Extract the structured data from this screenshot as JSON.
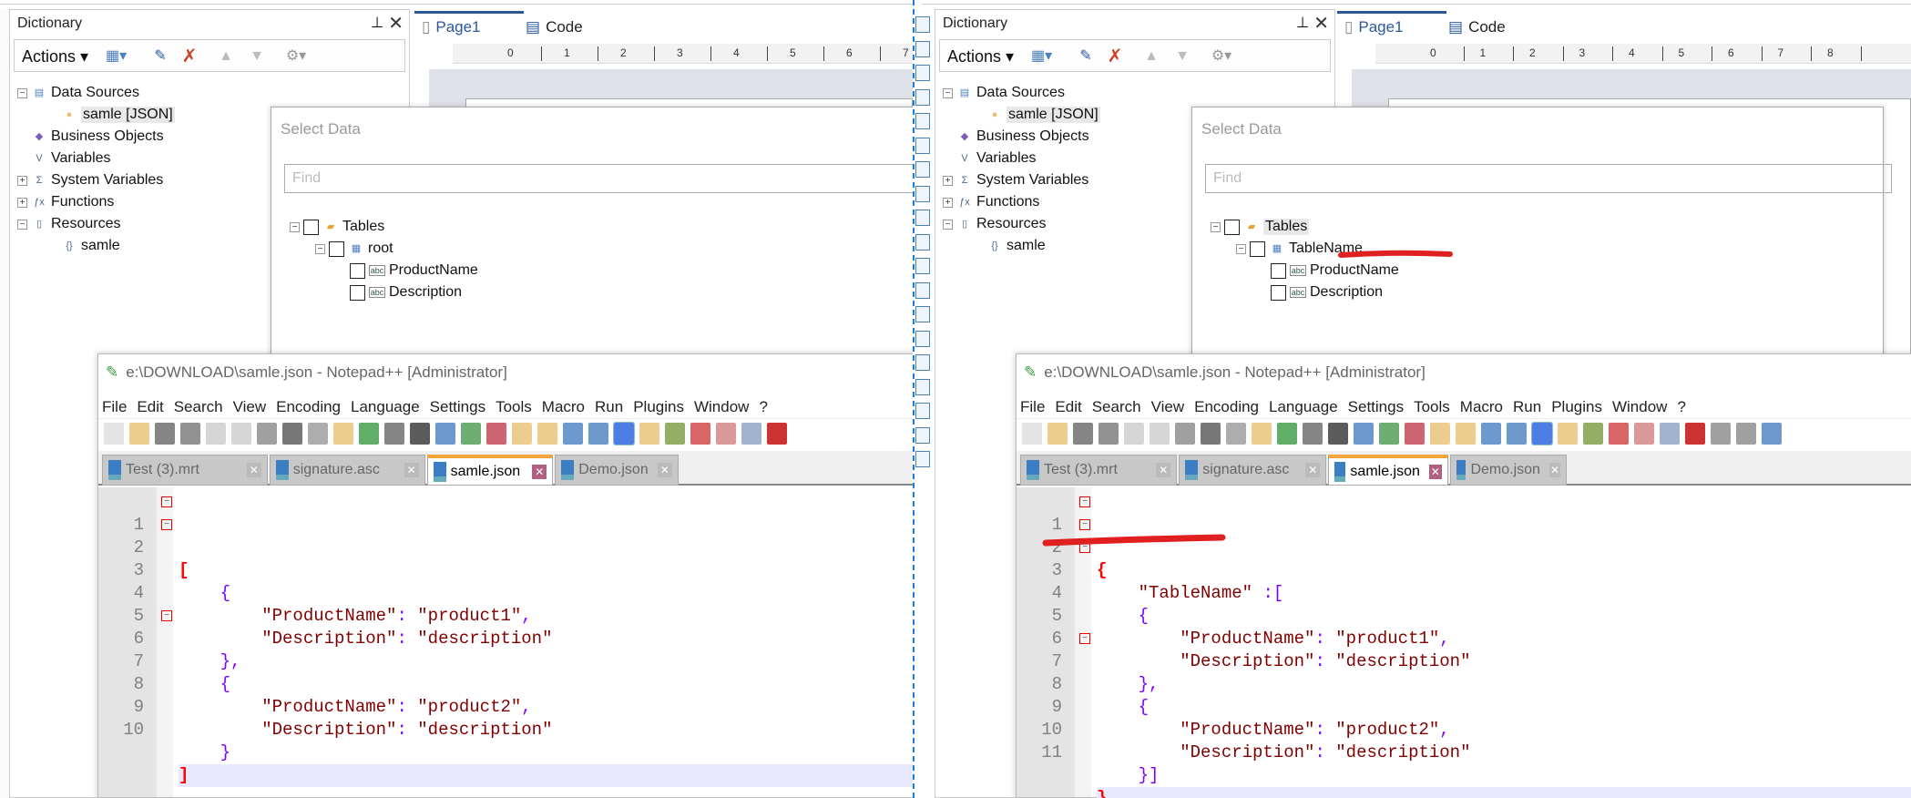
{
  "colors": {
    "accent": "#2b579a",
    "annotation": "#e02020",
    "tab_active": "#f6a43c",
    "string": "#800000",
    "operator": "#8000ff",
    "brace_match": "#ff0000",
    "current_line": "#e8e8ff"
  },
  "panels": [
    {
      "dictionary": {
        "title": "Dictionary",
        "actions_label": "Actions",
        "tree": [
          {
            "label": "Data Sources",
            "icon": "datasource-icon",
            "expander": "−",
            "level": 0
          },
          {
            "label": "samle [JSON]",
            "icon": "database-icon",
            "level": 1,
            "selected": true
          },
          {
            "label": "Business Objects",
            "icon": "business-objects-icon",
            "level": 0
          },
          {
            "label": "Variables",
            "icon": "variables-icon",
            "level": 0
          },
          {
            "label": "System Variables",
            "icon": "system-variables-icon",
            "expander": "+",
            "level": 0
          },
          {
            "label": "Functions",
            "icon": "function-icon",
            "expander": "+",
            "level": 0
          },
          {
            "label": "Resources",
            "icon": "resources-icon",
            "expander": "−",
            "level": 0
          },
          {
            "label": "samle",
            "icon": "json-icon",
            "level": 1
          }
        ]
      },
      "designer": {
        "tabs": [
          "Page1",
          "Code"
        ],
        "ruler": [
          "0",
          "1",
          "2",
          "3",
          "4",
          "5",
          "6",
          "7"
        ]
      },
      "select_data": {
        "title": "Select Data",
        "find_placeholder": "Find",
        "tree": [
          {
            "label": "Tables",
            "level": 0
          },
          {
            "label": "root",
            "level": 1
          },
          {
            "label": "ProductName",
            "level": 2
          },
          {
            "label": "Description",
            "level": 2
          }
        ]
      },
      "notepad": {
        "title": "e:\\DOWNLOAD\\samle.json - Notepad++ [Administrator]",
        "menu": [
          "File",
          "Edit",
          "Search",
          "View",
          "Encoding",
          "Language",
          "Settings",
          "Tools",
          "Macro",
          "Run",
          "Plugins",
          "Window",
          "?"
        ],
        "tabs": [
          {
            "label": "Test (3).mrt",
            "active": false
          },
          {
            "label": "signature.asc",
            "active": false
          },
          {
            "label": "samle.json",
            "active": true
          },
          {
            "label": "Demo.json",
            "active": false
          }
        ],
        "lines": [
          "[",
          "    {",
          "        \"ProductName\": \"product1\",",
          "        \"Description\": \"description\"",
          "    },",
          "    {",
          "        \"ProductName\": \"product2\",",
          "        \"Description\": \"description\"",
          "    }",
          "]"
        ],
        "current_line": 10
      }
    },
    {
      "dictionary": {
        "title": "Dictionary",
        "actions_label": "Actions",
        "tree": [
          {
            "label": "Data Sources",
            "icon": "datasource-icon",
            "expander": "−",
            "level": 0
          },
          {
            "label": "samle [JSON]",
            "icon": "database-icon",
            "level": 1,
            "selected": true
          },
          {
            "label": "Business Objects",
            "icon": "business-objects-icon",
            "level": 0
          },
          {
            "label": "Variables",
            "icon": "variables-icon",
            "level": 0
          },
          {
            "label": "System Variables",
            "icon": "system-variables-icon",
            "expander": "+",
            "level": 0
          },
          {
            "label": "Functions",
            "icon": "function-icon",
            "expander": "+",
            "level": 0
          },
          {
            "label": "Resources",
            "icon": "resources-icon",
            "expander": "−",
            "level": 0
          },
          {
            "label": "samle",
            "icon": "json-icon",
            "level": 1
          }
        ]
      },
      "designer": {
        "tabs": [
          "Page1",
          "Code"
        ],
        "ruler": [
          "0",
          "1",
          "2",
          "3",
          "4",
          "5",
          "6",
          "7",
          "8"
        ]
      },
      "select_data": {
        "title": "Select Data",
        "find_placeholder": "Find",
        "tree": [
          {
            "label": "Tables",
            "level": 0
          },
          {
            "label": "TableName",
            "level": 1
          },
          {
            "label": "ProductName",
            "level": 2
          },
          {
            "label": "Description",
            "level": 2
          }
        ]
      },
      "notepad": {
        "title": "e:\\DOWNLOAD\\samle.json - Notepad++ [Administrator]",
        "menu": [
          "File",
          "Edit",
          "Search",
          "View",
          "Encoding",
          "Language",
          "Settings",
          "Tools",
          "Macro",
          "Run",
          "Plugins",
          "Window",
          "?"
        ],
        "tabs": [
          {
            "label": "Test (3).mrt",
            "active": false
          },
          {
            "label": "signature.asc",
            "active": false
          },
          {
            "label": "samle.json",
            "active": true
          },
          {
            "label": "Demo.json",
            "active": false
          }
        ],
        "lines": [
          "{",
          "    \"TableName\" :[",
          "    {",
          "        \"ProductName\": \"product1\",",
          "        \"Description\": \"description\"",
          "    },",
          "    {",
          "        \"ProductName\": \"product2\",",
          "        \"Description\": \"description\"",
          "    }]",
          "}"
        ],
        "current_line": 11
      }
    }
  ]
}
